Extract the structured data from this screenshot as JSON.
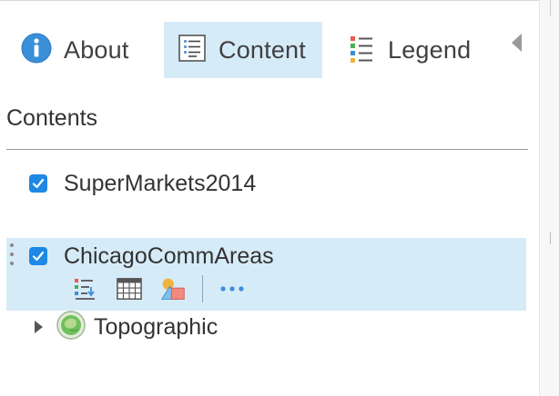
{
  "tabs": {
    "about": "About",
    "content": "Content",
    "legend": "Legend"
  },
  "contents": {
    "heading": "Contents"
  },
  "layers": [
    {
      "label": "SuperMarkets2014",
      "checked": true
    },
    {
      "label": "ChicagoCommAreas",
      "checked": true,
      "selected": true
    },
    {
      "label": "Topographic",
      "type": "basemap",
      "expanded": false
    }
  ],
  "layer_tools": [
    "legend-icon",
    "attribute-table-icon",
    "symbology-icon",
    "more-icon"
  ],
  "colors": {
    "accent": "#1e88e5",
    "selected_bg": "#d6ebf8",
    "text": "#333333"
  }
}
